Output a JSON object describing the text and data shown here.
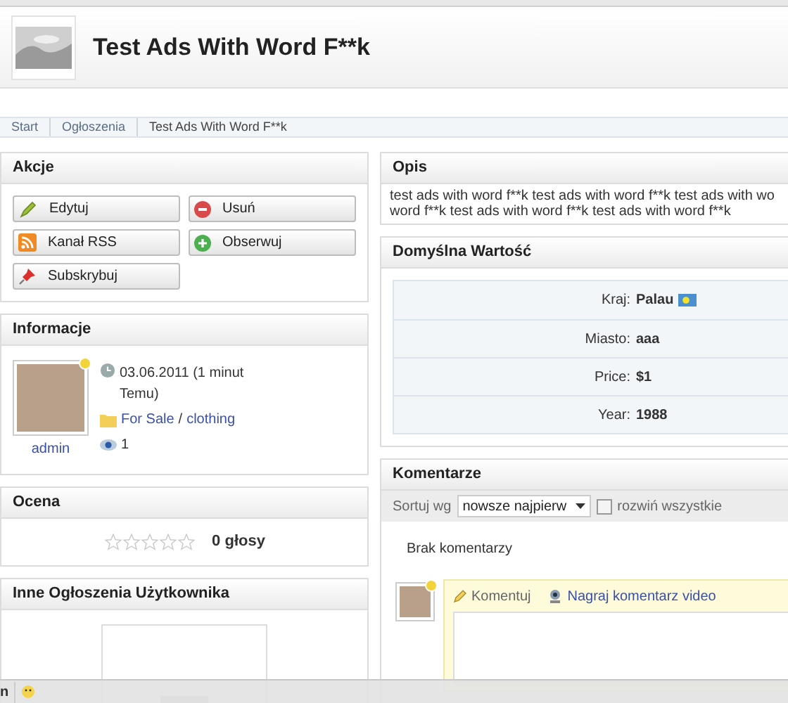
{
  "header": {
    "title": "Test Ads With Word F**k"
  },
  "breadcrumb": [
    {
      "label": "Start"
    },
    {
      "label": "Ogłoszenia"
    },
    {
      "label": "Test Ads With Word F**k"
    }
  ],
  "actions": {
    "title": "Akcje",
    "buttons": [
      {
        "label": "Edytuj",
        "kind": "edit"
      },
      {
        "label": "Usuń",
        "kind": "delete"
      },
      {
        "label": "Kanał RSS",
        "kind": "rss"
      },
      {
        "label": "Obserwuj",
        "kind": "follow"
      },
      {
        "label": "Subskrybuj",
        "kind": "subscribe"
      }
    ]
  },
  "info": {
    "title": "Informacje",
    "user": "admin",
    "date": "03.06.2011 (1 minut Temu)",
    "category": "For Sale",
    "subcategory": "clothing",
    "separator": "/",
    "views": "1"
  },
  "rating": {
    "title": "Ocena",
    "stars": 0,
    "votes": "0 głosy"
  },
  "other_ads": {
    "title": "Inne Ogłoszenia Użytkownika"
  },
  "description": {
    "title": "Opis",
    "lines": [
      "test ads with word f**k test ads with word f**k test ads with wo",
      "word f**k test ads with word f**k test ads with word f**k"
    ]
  },
  "fields": {
    "title": "Domyślna Wartość",
    "rows": [
      {
        "label": "Kraj:",
        "value": "Palau",
        "kind": "flag"
      },
      {
        "label": "Miasto:",
        "value": "aaa",
        "kind": "text"
      },
      {
        "label": "Price:",
        "value": "$1",
        "kind": "text"
      },
      {
        "label": "Year:",
        "value": "1988",
        "kind": "text"
      }
    ]
  },
  "comments": {
    "title": "Komentarze",
    "sort_label": "Sortuj wg",
    "sort_value": "nowsze najpierw",
    "expand_all": {
      "label": "rozwiń wszystkie",
      "checked": false
    },
    "empty": "Brak komentarzy",
    "tabs": [
      {
        "label": "Komentuj",
        "selected": true
      },
      {
        "label": "Nagraj komentarz video",
        "selected": false
      }
    ]
  },
  "bottom_bar": {
    "text": "n"
  }
}
